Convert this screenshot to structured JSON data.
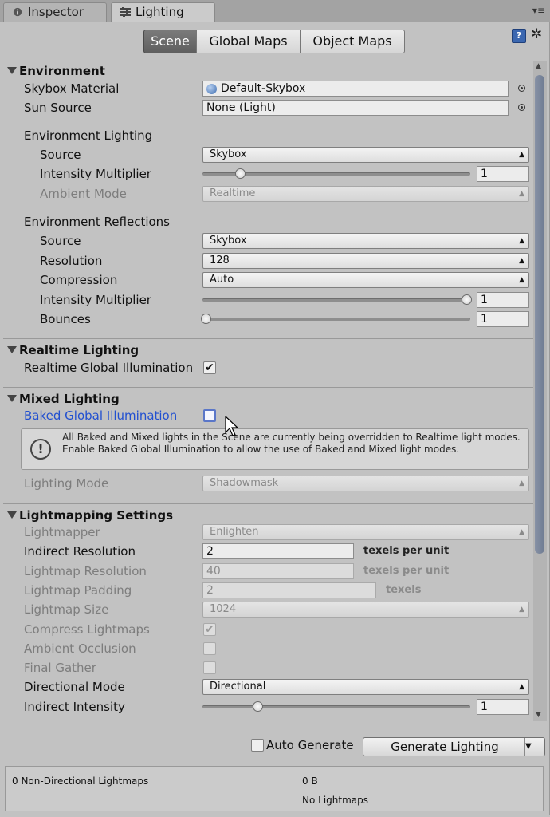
{
  "tabs": {
    "inspector": "Inspector",
    "lighting": "Lighting",
    "menu": "▾≡"
  },
  "modes": [
    "Scene",
    "Global Maps",
    "Object Maps"
  ],
  "toolbar": {
    "help": "?",
    "settings": "✲"
  },
  "environment": {
    "header": "Environment",
    "skybox_material": {
      "label": "Skybox Material",
      "value": "Default-Skybox"
    },
    "sun_source": {
      "label": "Sun Source",
      "value": "None (Light)"
    },
    "lighting": {
      "header": "Environment Lighting",
      "source": {
        "label": "Source",
        "value": "Skybox"
      },
      "intensity": {
        "label": "Intensity Multiplier",
        "value": "1",
        "fraction": 0.13
      },
      "ambient_mode": {
        "label": "Ambient Mode",
        "value": "Realtime"
      }
    },
    "reflections": {
      "header": "Environment Reflections",
      "source": {
        "label": "Source",
        "value": "Skybox"
      },
      "resolution": {
        "label": "Resolution",
        "value": "128"
      },
      "compression": {
        "label": "Compression",
        "value": "Auto"
      },
      "intensity": {
        "label": "Intensity Multiplier",
        "value": "1",
        "fraction": 1.0
      },
      "bounces": {
        "label": "Bounces",
        "value": "1",
        "fraction": 0.0
      }
    }
  },
  "realtime": {
    "header": "Realtime Lighting",
    "gi": {
      "label": "Realtime Global Illumination",
      "checked": true
    }
  },
  "mixed": {
    "header": "Mixed Lighting",
    "baked_gi": {
      "label": "Baked Global Illumination",
      "checked": false
    },
    "help": "All Baked and Mixed lights in the Scene are currently being overridden to Realtime light modes. Enable Baked Global Illumination to allow the use of Baked and Mixed light modes.",
    "lighting_mode": {
      "label": "Lighting Mode",
      "value": "Shadowmask"
    }
  },
  "lightmapping": {
    "header": "Lightmapping Settings",
    "lightmapper": {
      "label": "Lightmapper",
      "value": "Enlighten"
    },
    "indirect_resolution": {
      "label": "Indirect Resolution",
      "value": "2",
      "unit": "texels per unit"
    },
    "lightmap_resolution": {
      "label": "Lightmap Resolution",
      "value": "40",
      "unit": "texels per unit"
    },
    "lightmap_padding": {
      "label": "Lightmap Padding",
      "value": "2",
      "unit": "texels"
    },
    "lightmap_size": {
      "label": "Lightmap Size",
      "value": "1024"
    },
    "compress": {
      "label": "Compress Lightmaps",
      "checked": true
    },
    "ambient_occlusion": {
      "label": "Ambient Occlusion",
      "checked": false
    },
    "final_gather": {
      "label": "Final Gather",
      "checked": false
    },
    "directional_mode": {
      "label": "Directional Mode",
      "value": "Directional"
    },
    "indirect_intensity": {
      "label": "Indirect Intensity",
      "value": "1",
      "fraction": 0.2
    }
  },
  "actions": {
    "auto_generate": {
      "label": "Auto Generate",
      "checked": false
    },
    "generate": "Generate Lighting"
  },
  "footer": {
    "lightmaps": "0 Non-Directional Lightmaps",
    "size": "0 B",
    "status": "No Lightmaps"
  }
}
